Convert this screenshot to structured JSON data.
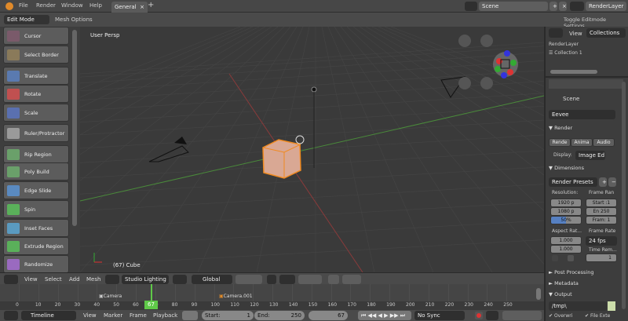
{
  "menu": {
    "items": [
      "File",
      "Render",
      "Window",
      "Help"
    ],
    "tab": "General",
    "add_tab": "+"
  },
  "scene": {
    "name": "Scene",
    "render_layer": "RenderLayer"
  },
  "header": {
    "mode": "Edit Mode",
    "mesh_options": "Mesh Options",
    "toggle_editmode": "Toggle Editmode Settings"
  },
  "tools": [
    "Cursor",
    "Select Border",
    "Translate",
    "Rotate",
    "Scale",
    "Ruler/Protractor",
    "Rip Region",
    "Poly Build",
    "Edge Slide",
    "Spin",
    "Inset Faces",
    "Extrude Region",
    "Randomize"
  ],
  "tool_colors": [
    "#7a5a6a",
    "#8a7a5a",
    "#5a7ab0",
    "#c05050",
    "#5a70b0",
    "#9a9a9a",
    "#6aa06a",
    "#6aa06a",
    "#5a8ac0",
    "#5ab05a",
    "#5a9ac0",
    "#5ab05a",
    "#9a6ac0"
  ],
  "viewport": {
    "label": "User Persp",
    "object_info": "(67) Cube"
  },
  "vp_header": {
    "menus": [
      "View",
      "Select",
      "Add",
      "Mesh"
    ],
    "shading": "Studio Lighting",
    "orientation": "Global"
  },
  "timeline": {
    "ticks": [
      "0",
      "10",
      "20",
      "30",
      "40",
      "50",
      "60",
      "70",
      "80",
      "90",
      "100",
      "110",
      "120",
      "130",
      "140",
      "150",
      "160",
      "170",
      "180",
      "190",
      "200",
      "210",
      "220",
      "230",
      "240",
      "250"
    ],
    "current": "67",
    "markers": [
      "Camera",
      "Camera.001"
    ]
  },
  "tl_header": {
    "editor": "Timeline",
    "menus": [
      "View",
      "Marker",
      "Frame",
      "Playback"
    ],
    "start_label": "Start:",
    "start": "1",
    "end_label": "End:",
    "end": "250",
    "frame": "67",
    "sync": "No Sync"
  },
  "outliner": {
    "view": "View",
    "collections": "Collections",
    "layer": "RenderLayer",
    "collection": "Collection 1"
  },
  "props": {
    "scene": "Scene",
    "engine": "Eevee",
    "render": "Render",
    "render_btns": [
      "Rende",
      "Anima",
      "Audio"
    ],
    "display_label": "Display:",
    "display": "Image Ed",
    "dimensions": "Dimensions",
    "presets": "Render Presets",
    "resolution": "Resolution:",
    "res_x": "1920 p",
    "res_y": "1080 p",
    "res_pct": "50%",
    "frame_range": "Frame Ran",
    "start": "Start :1",
    "end": "En 250",
    "step": "Fram: 1",
    "aspect": "Aspect Rat...",
    "asp_x": "1.000",
    "asp_y": "1.000",
    "frame_rate": "Frame Rate",
    "fps": "24 fps",
    "time_remap": "Time Rem...",
    "remap_val": "1",
    "post": "Post Processing",
    "metadata": "Metadata",
    "output": "Output",
    "path": "/tmp\\",
    "overwrite": "Overwri",
    "file_ext": "File Exte"
  }
}
